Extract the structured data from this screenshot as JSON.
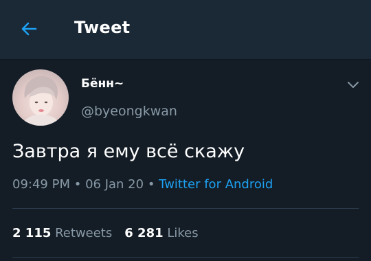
{
  "header": {
    "title": "Tweet",
    "back_icon": "arrow-left-icon",
    "accent_color": "#1da1f2"
  },
  "tweet": {
    "display_name": "Бённ~",
    "handle": "@byeongkwan",
    "text": "Завтра я ему всё скажу",
    "time": "09:49 PM",
    "separator": "•",
    "date": "06 Jan 20",
    "source": "Twitter for Android",
    "menu_icon": "chevron-down-icon"
  },
  "stats": {
    "retweets_count": "2 115",
    "retweets_label": "Retweets",
    "likes_count": "6 281",
    "likes_label": "Likes"
  }
}
